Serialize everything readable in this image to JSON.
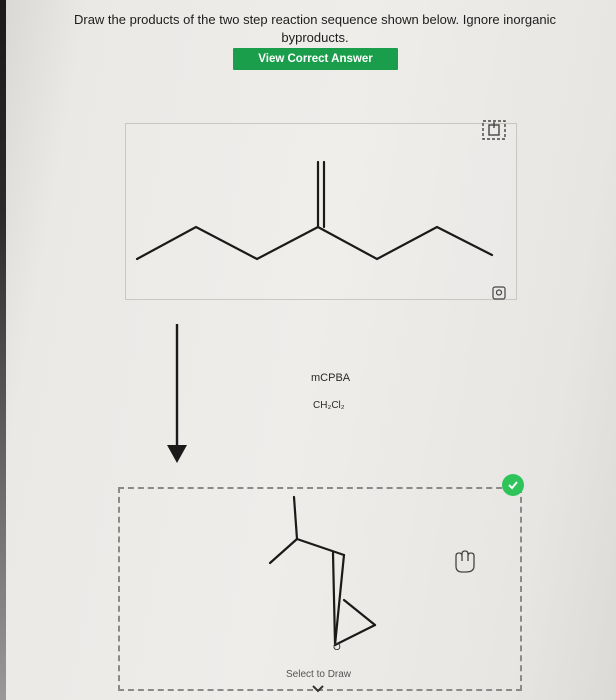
{
  "question": {
    "line1": "Draw the products of the two step reaction sequence shown below. Ignore inorganic",
    "line2": "byproducts."
  },
  "answer_button": {
    "label": "View Correct Answer"
  },
  "reagents": {
    "step1": "mCPBA",
    "step2": "CH₂Cl₂"
  },
  "product_atom_label": "O",
  "answer_area": {
    "select_label": "Select to Draw"
  },
  "colors": {
    "accent_green": "#1b9e4b",
    "check_green": "#2ec45a",
    "bond": "#1a1a1a"
  },
  "icons": [
    "expand-icon",
    "zoom-icon",
    "hand-icon",
    "checkmark-icon",
    "chevron-down-icon",
    "arrow-down-icon"
  ]
}
